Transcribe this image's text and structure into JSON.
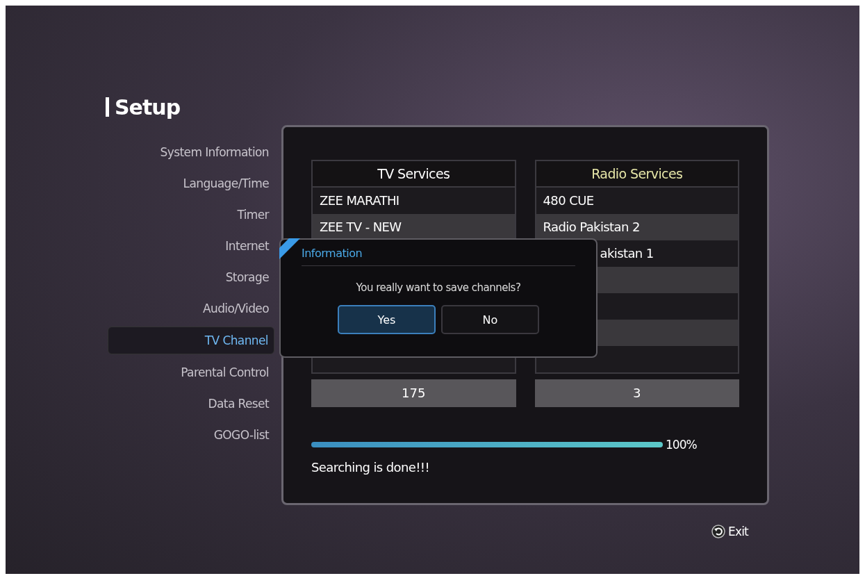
{
  "title": "Setup",
  "sidebar": {
    "items": [
      {
        "label": "System Information",
        "selected": false
      },
      {
        "label": "Language/Time",
        "selected": false
      },
      {
        "label": "Timer",
        "selected": false
      },
      {
        "label": "Internet",
        "selected": false
      },
      {
        "label": "Storage",
        "selected": false
      },
      {
        "label": "Audio/Video",
        "selected": false
      },
      {
        "label": "TV Channel",
        "selected": true
      },
      {
        "label": "Parental Control",
        "selected": false
      },
      {
        "label": "Data Reset",
        "selected": false
      },
      {
        "label": "GOGO-list",
        "selected": false
      }
    ]
  },
  "tv_services": {
    "title": "TV Services",
    "count": "175",
    "rows": [
      {
        "label": "ZEE  MARATHI"
      },
      {
        "label": "ZEE TV - NEW"
      }
    ]
  },
  "radio_services": {
    "title": "Radio Services",
    "count": "3",
    "rows": [
      {
        "label": "480 CUE",
        "kind": "full"
      },
      {
        "label": "Radio Pakistan 2",
        "kind": "full"
      },
      {
        "label": "akistan 1",
        "kind": "partial"
      }
    ]
  },
  "progress": {
    "level": 1.0,
    "reading": "100%"
  },
  "status": "Searching is done!!!",
  "dialog": {
    "title": "Information",
    "message": "You really want to save channels?",
    "buttons": [
      {
        "label": "Yes",
        "selected": true
      },
      {
        "label": "No",
        "selected": false
      }
    ]
  },
  "exit": {
    "label": "Exit"
  }
}
